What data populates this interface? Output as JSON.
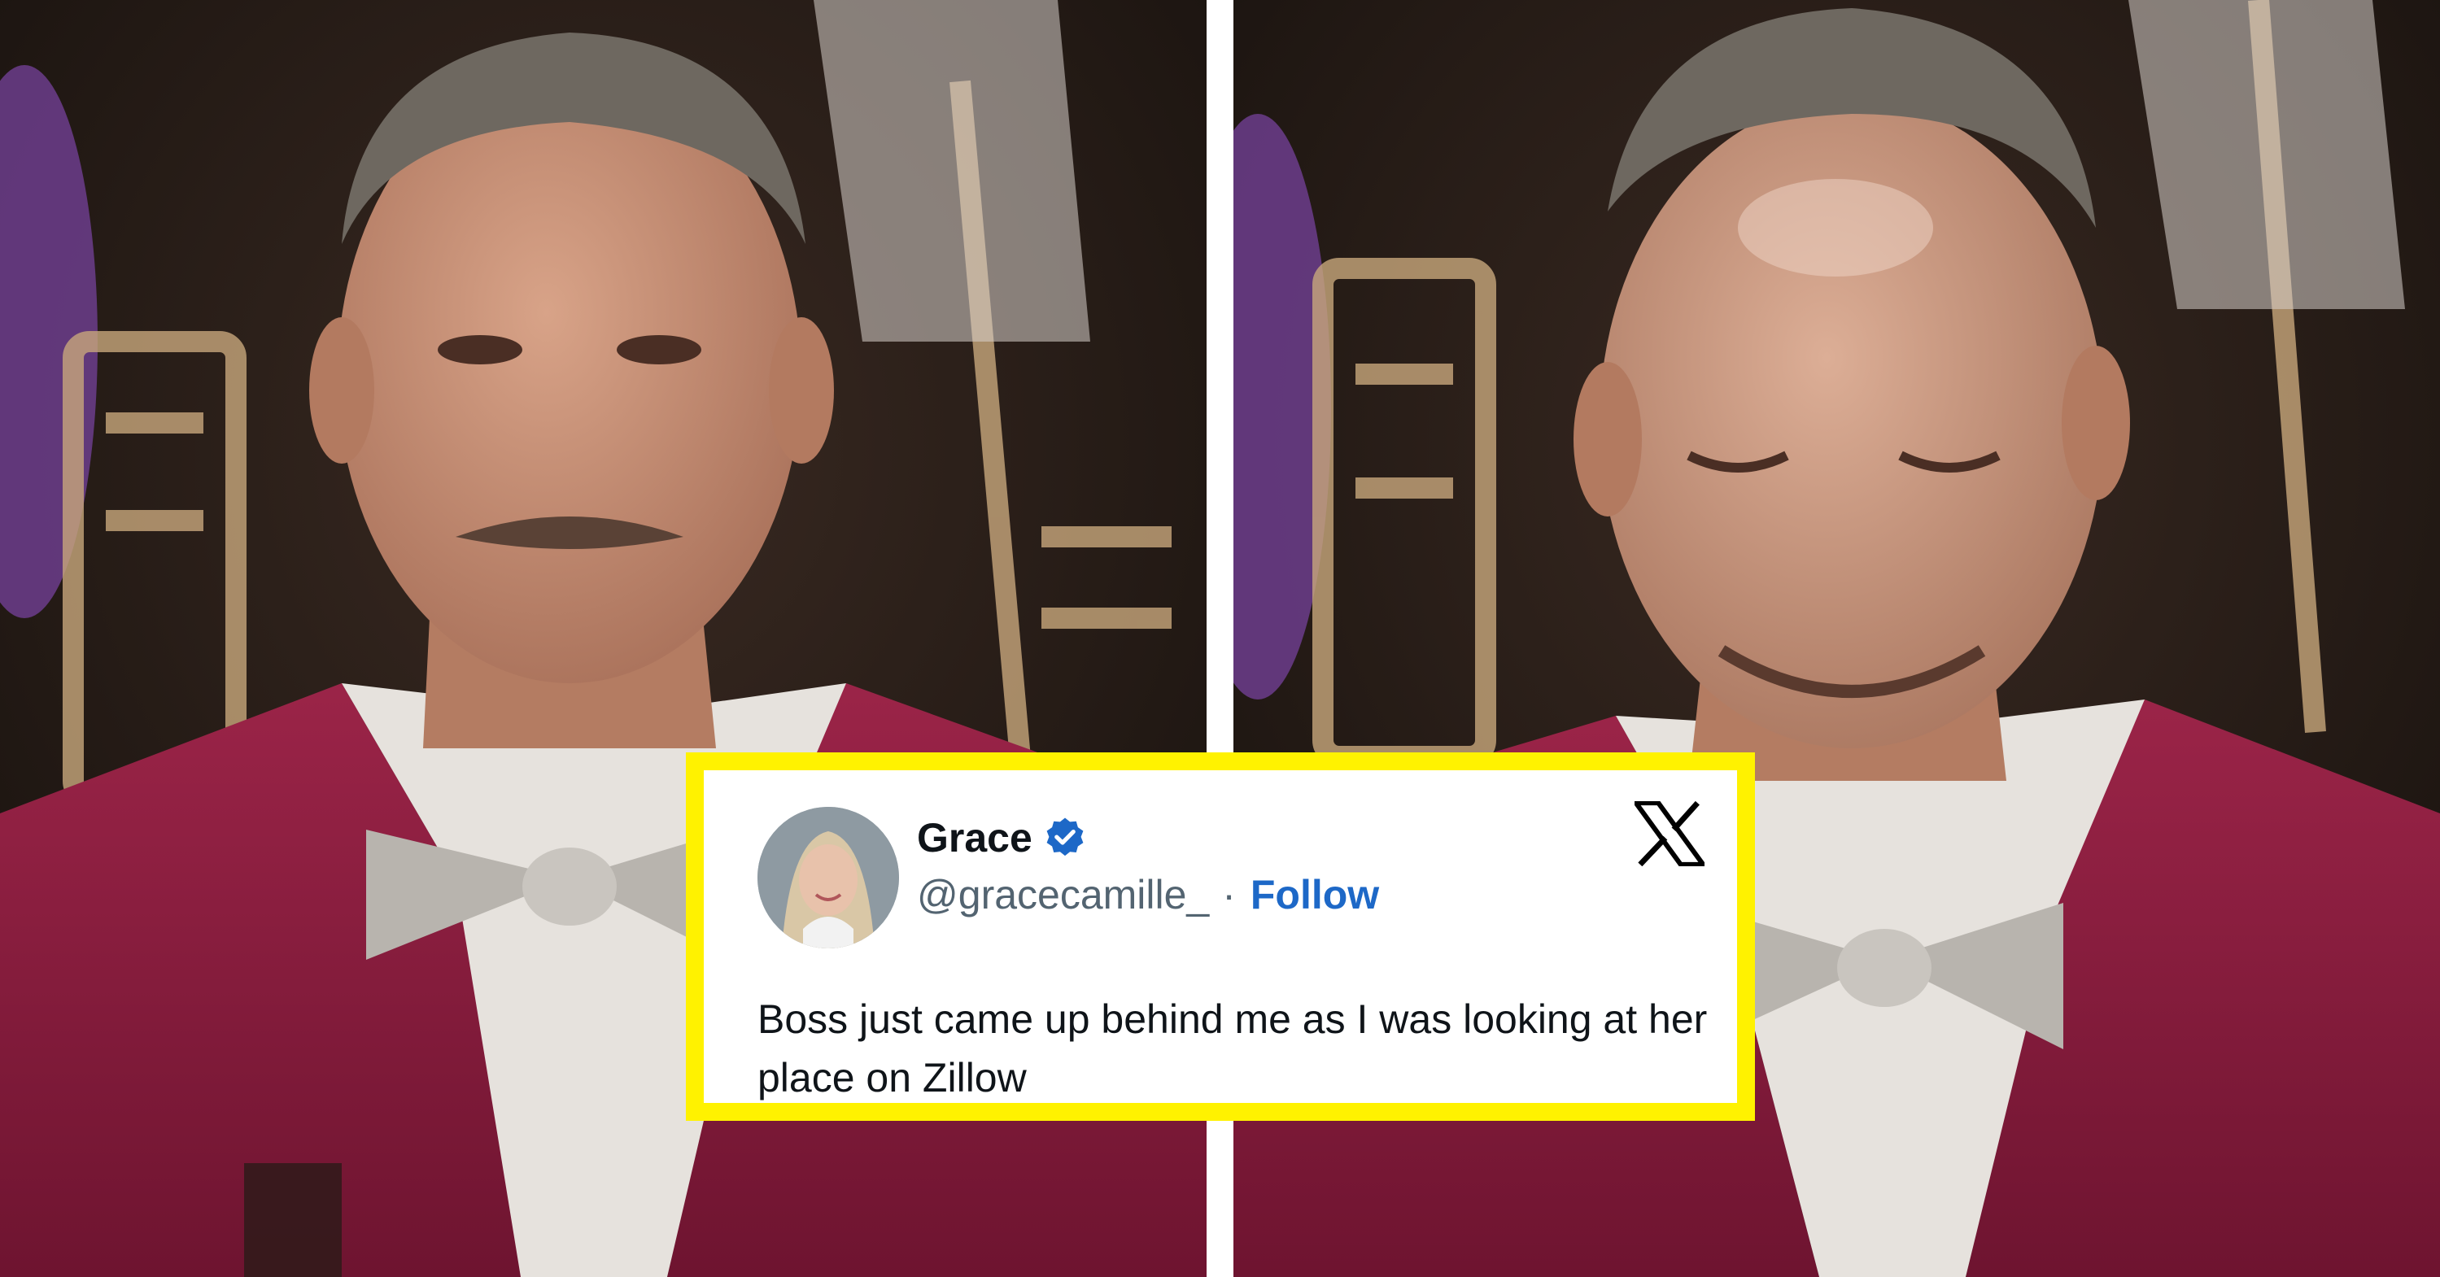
{
  "tweet": {
    "display_name": "Grace",
    "handle": "@gracecamille_",
    "separator": "·",
    "follow_label": "Follow",
    "verified": true,
    "platform_icon": "x-logo-icon",
    "text": "Boss just came up behind me as I was looking at her place on Zillow"
  },
  "colors": {
    "card_border": "#fff200",
    "follow_link": "#1d68c7",
    "verified_badge": "#1d68c7",
    "jacket": "#8b1e3f",
    "background_dark": "#1f1612"
  }
}
